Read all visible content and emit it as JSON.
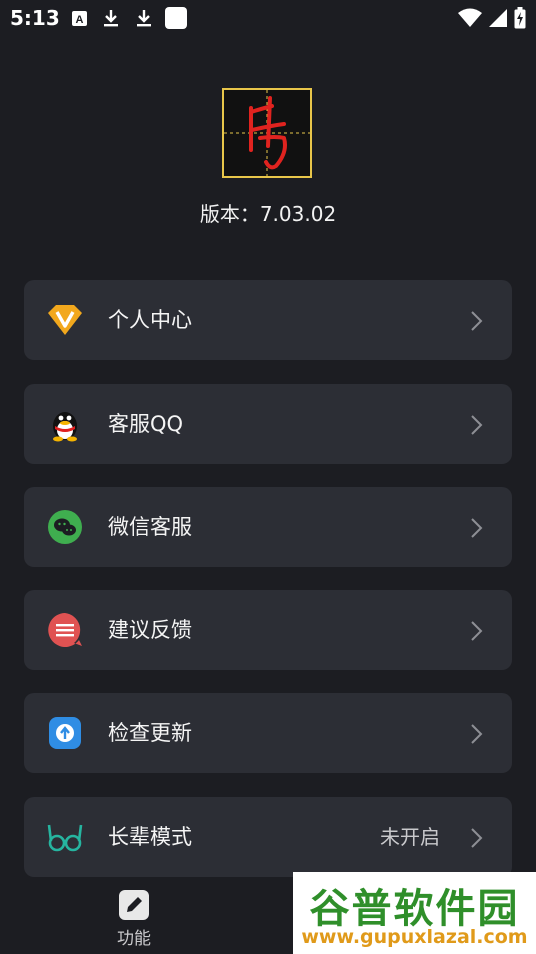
{
  "status_bar": {
    "time": "5:13",
    "icons": [
      "a-box-icon",
      "download-icon",
      "download-icon",
      "app-square-icon",
      "wifi-icon",
      "signal-icon",
      "battery-charging-icon"
    ]
  },
  "app": {
    "version_text": "版本：7.03.02"
  },
  "menu": {
    "items": [
      {
        "label": "个人中心",
        "icon": "vip-diamond-icon",
        "value": ""
      },
      {
        "label": "客服QQ",
        "icon": "qq-penguin-icon",
        "value": ""
      },
      {
        "label": "微信客服",
        "icon": "wechat-icon",
        "value": ""
      },
      {
        "label": "建议反馈",
        "icon": "feedback-icon",
        "value": ""
      },
      {
        "label": "检查更新",
        "icon": "update-icon",
        "value": ""
      },
      {
        "label": "长辈模式",
        "icon": "glasses-icon",
        "value": "未开启"
      }
    ]
  },
  "bottom_nav": {
    "function_label": "功能"
  },
  "watermark": {
    "title": "谷普软件园",
    "url": "www.gupuxlazal.com"
  },
  "colors": {
    "background": "#1c1d22",
    "card": "#2c2e35",
    "logo_border": "#e8c64a",
    "logo_stroke": "#e0231f"
  }
}
